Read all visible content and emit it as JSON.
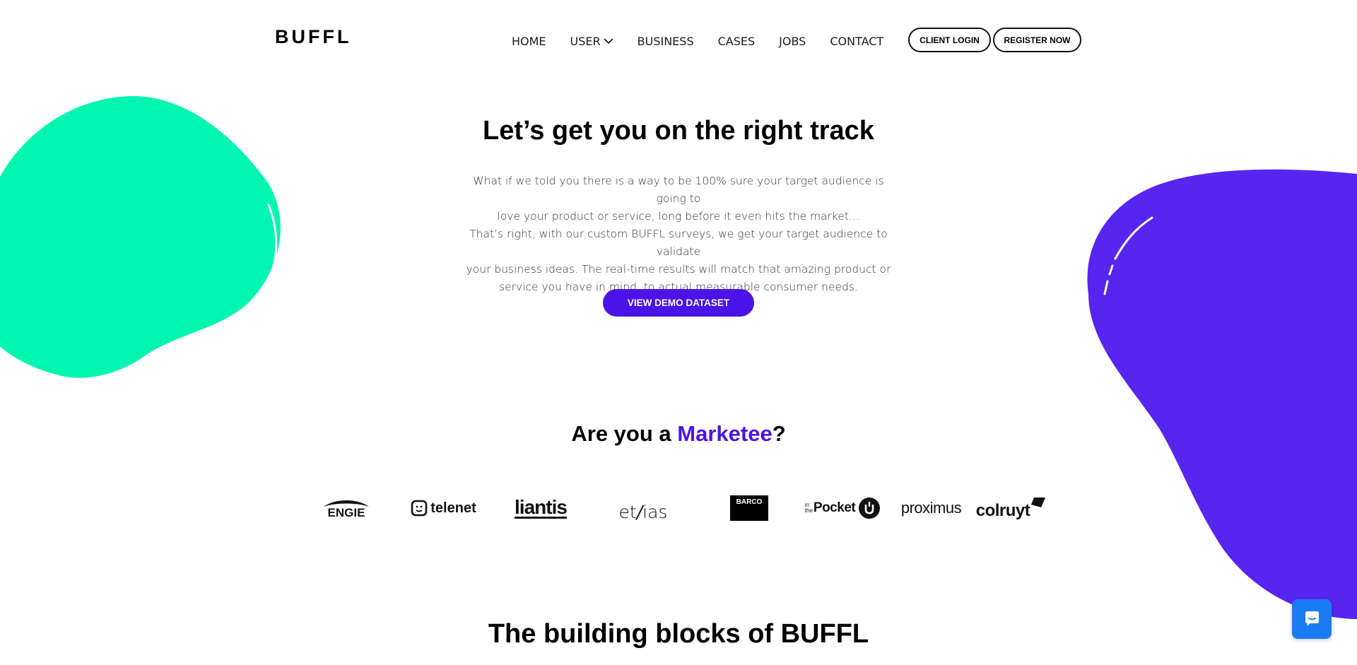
{
  "brand": {
    "logo": "BUFFL"
  },
  "nav": {
    "items": [
      "HOME",
      "USER",
      "BUSINESS",
      "CASES",
      "JOBS",
      "CONTACT"
    ],
    "client_login": "CLIENT LOGIN",
    "register": "REGISTER NOW"
  },
  "hero": {
    "title": "Let’s get you on the right track",
    "lines": [
      "What if we told you there is a way to be 100% sure your target audience is going to",
      "love your product or service, long before it even hits the market…",
      "That’s right, with our custom BUFFL surveys, we get your target audience to validate",
      "your business ideas. The real-time results will match that amazing product or",
      "service you have in mind, to actual measurable consumer needs."
    ],
    "cta": "VIEW DEMO DATASET"
  },
  "marketee": {
    "prefix": "Are you a ",
    "accent": "Marketee",
    "suffix": "?"
  },
  "clients": {
    "engie": "ENGIE",
    "telenet": "telenet",
    "liantis": "liantis",
    "ethias_a": "et",
    "ethias_b": "ias",
    "barco": "BARCO",
    "inthepocket_small_a": "in",
    "inthepocket_small_b": "the",
    "inthepocket": "Pocket",
    "proximus": "proximus",
    "colruyt": "colruyt"
  },
  "section2": {
    "title": "The building blocks of BUFFL"
  },
  "colors": {
    "accent": "#4a14e8",
    "green": "#00f5b0",
    "purple": "#5625f0",
    "chat": "#1a7cf5"
  },
  "icons": {
    "chevron": "chevron-down-icon",
    "chat": "chat-icon"
  }
}
